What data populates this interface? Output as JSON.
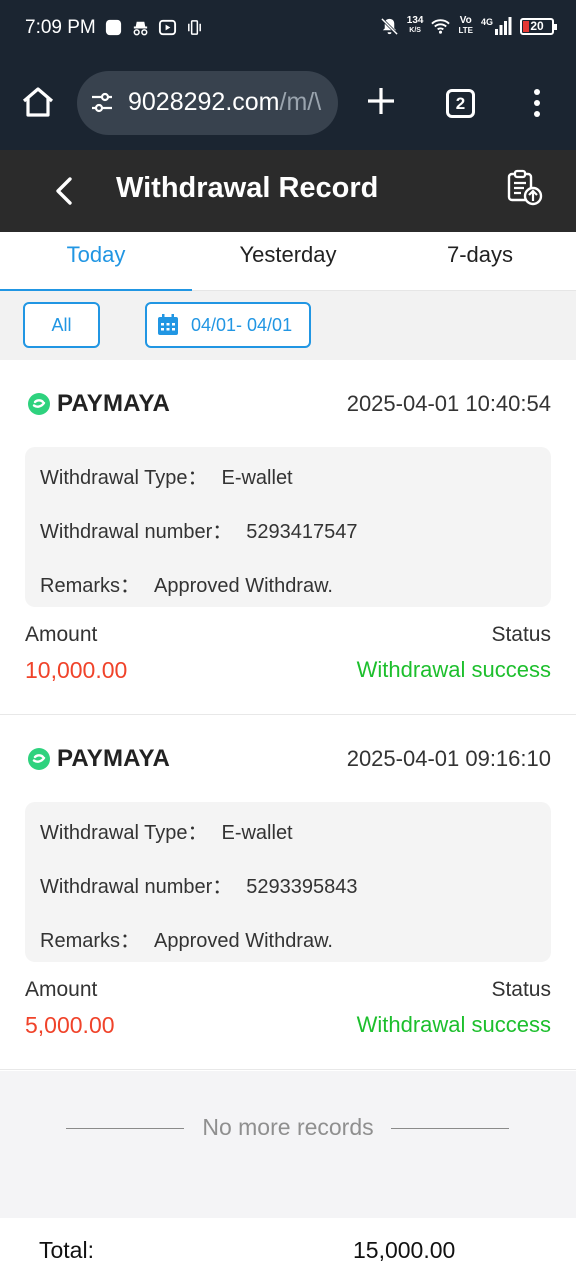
{
  "status_bar": {
    "time": "7:09 PM",
    "network_speed_top": "134",
    "network_speed_bottom": "K/S",
    "volte_top": "Vo",
    "volte_bottom": "LTE",
    "signal_type": "4G",
    "battery": "20"
  },
  "browser": {
    "url": "9028292.com",
    "url_path": "/m/\\",
    "tab_count": "2"
  },
  "header": {
    "title": "Withdrawal Record"
  },
  "tabs": [
    {
      "label": "Today",
      "active": true
    },
    {
      "label": "Yesterday",
      "active": false
    },
    {
      "label": "7-days",
      "active": false
    }
  ],
  "filters": {
    "all_label": "All",
    "date_range": "04/01- 04/01"
  },
  "records": [
    {
      "provider": "PAYMAYA",
      "datetime": "2025-04-01 10:40:54",
      "type_label": "Withdrawal Type：",
      "type_value": "E-wallet",
      "number_label": "Withdrawal number：",
      "number_value": "5293417547",
      "remarks_label": "Remarks：",
      "remarks_value": "Approved Withdraw.",
      "amount_label": "Amount",
      "amount": "10,000.00",
      "status_label": "Status",
      "status": "Withdrawal success"
    },
    {
      "provider": "PAYMAYA",
      "datetime": "2025-04-01 09:16:10",
      "type_label": "Withdrawal Type：",
      "type_value": "E-wallet",
      "number_label": "Withdrawal number：",
      "number_value": "5293395843",
      "remarks_label": "Remarks：",
      "remarks_value": "Approved Withdraw.",
      "amount_label": "Amount",
      "amount": "5,000.00",
      "status_label": "Status",
      "status": "Withdrawal success"
    }
  ],
  "footer": {
    "no_more": "No more records",
    "total_label": "Total:",
    "total_value": "15,000.00"
  },
  "colors": {
    "accent": "#2196e3",
    "amount": "#f0432a",
    "success": "#1dbf2d",
    "header_bg": "#2b2b2b",
    "browser_bg": "#1b2531"
  }
}
